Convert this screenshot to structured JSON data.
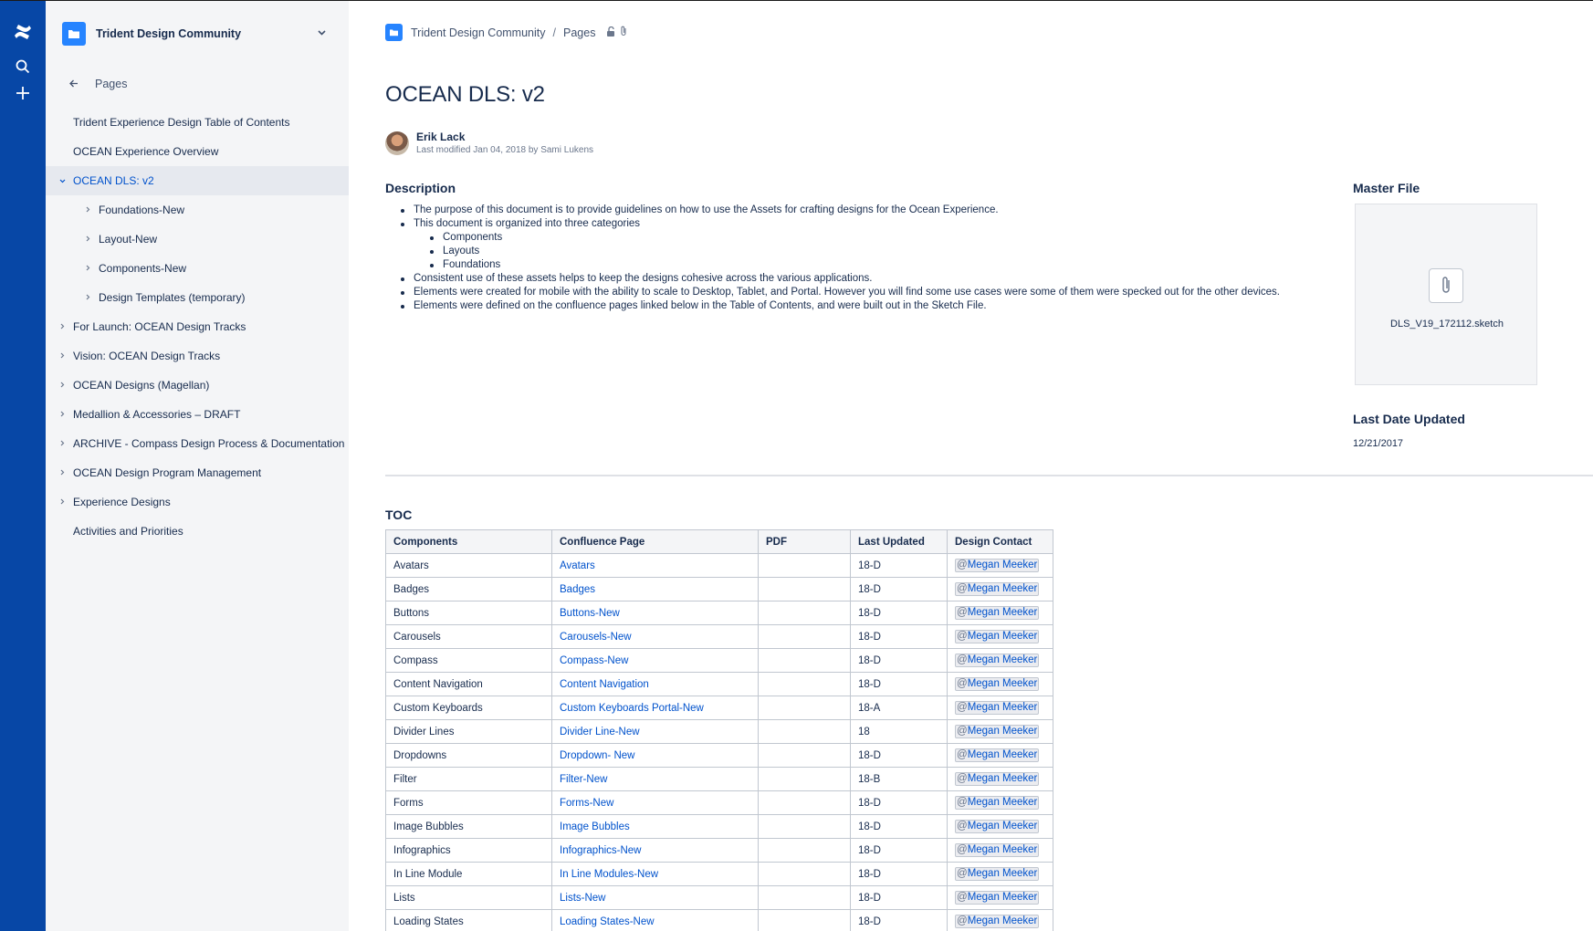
{
  "global_nav": {
    "icons": [
      "confluence-logo-icon",
      "search-icon",
      "create-icon"
    ]
  },
  "sidebar": {
    "space_name": "Trident Design Community",
    "pages_label": "Pages",
    "items": [
      {
        "label": "Trident Experience Design Table of Contents",
        "level": 0,
        "has_children": false,
        "expanded": false,
        "active": false
      },
      {
        "label": "OCEAN Experience Overview",
        "level": 0,
        "has_children": false,
        "expanded": false,
        "active": false
      },
      {
        "label": "OCEAN DLS: v2",
        "level": 0,
        "has_children": true,
        "expanded": true,
        "active": true
      },
      {
        "label": "Foundations-New",
        "level": 1,
        "has_children": true,
        "expanded": false,
        "active": false
      },
      {
        "label": "Layout-New",
        "level": 1,
        "has_children": true,
        "expanded": false,
        "active": false
      },
      {
        "label": "Components-New",
        "level": 1,
        "has_children": true,
        "expanded": false,
        "active": false
      },
      {
        "label": "Design Templates (temporary)",
        "level": 1,
        "has_children": true,
        "expanded": false,
        "active": false
      },
      {
        "label": "For Launch: OCEAN Design Tracks",
        "level": 0,
        "has_children": true,
        "expanded": false,
        "active": false
      },
      {
        "label": "Vision: OCEAN Design Tracks",
        "level": 0,
        "has_children": true,
        "expanded": false,
        "active": false
      },
      {
        "label": "OCEAN Designs (Magellan)",
        "level": 0,
        "has_children": true,
        "expanded": false,
        "active": false
      },
      {
        "label": "Medallion & Accessories – DRAFT",
        "level": 0,
        "has_children": true,
        "expanded": false,
        "active": false
      },
      {
        "label": "ARCHIVE - Compass Design Process & Documentation",
        "level": 0,
        "has_children": true,
        "expanded": false,
        "active": false
      },
      {
        "label": "OCEAN Design Program Management",
        "level": 0,
        "has_children": true,
        "expanded": false,
        "active": false
      },
      {
        "label": "Experience Designs",
        "level": 0,
        "has_children": true,
        "expanded": false,
        "active": false
      },
      {
        "label": "Activities and Priorities",
        "level": 0,
        "has_children": false,
        "expanded": false,
        "active": false
      }
    ]
  },
  "breadcrumb": {
    "space": "Trident Design Community",
    "separator": "/",
    "pages": "Pages"
  },
  "page": {
    "title": "OCEAN DLS: v2",
    "author": "Erik Lack",
    "last_modified": "Last modified Jan 04, 2018 by Sami Lukens"
  },
  "description": {
    "heading": "Description",
    "bullets": [
      {
        "text": "The purpose of this document is to provide guidelines on how to use the Assets for crafting designs for the Ocean Experience.",
        "level": 0
      },
      {
        "text": "This document is organized into three categories",
        "level": 0
      },
      {
        "text": "Components",
        "level": 1
      },
      {
        "text": "Layouts",
        "level": 1
      },
      {
        "text": "Foundations",
        "level": 1
      },
      {
        "text": " Consistent use of these assets helps to keep the designs cohesive across the various applications.",
        "level": 0
      },
      {
        "text": "Elements were created for mobile with the ability to scale to Desktop, Tablet, and Portal. However you will find some use cases were some of them were specked out for the other devices.",
        "level": 0
      },
      {
        "text": "Elements were defined on the confluence pages linked below in the Table of Contents, and were built out in the Sketch File.",
        "level": 0
      }
    ]
  },
  "master_file": {
    "heading": "Master File",
    "filename": "DLS_V19_172112.sketch"
  },
  "last_date_updated": {
    "heading": "Last Date Updated",
    "value": "12/21/2017"
  },
  "toc": {
    "heading": "TOC",
    "columns": [
      "Components",
      "Confluence Page",
      "PDF",
      "Last Updated",
      "Design Contact"
    ],
    "rows": [
      {
        "component": "Avatars",
        "page": "Avatars",
        "pdf": "",
        "updated": "18-D",
        "contact": "Megan Meeker"
      },
      {
        "component": "Badges",
        "page": "Badges",
        "pdf": "",
        "updated": "18-D",
        "contact": "Megan Meeker"
      },
      {
        "component": "Buttons",
        "page": "Buttons-New",
        "pdf": "",
        "updated": "18-D",
        "contact": "Megan Meeker"
      },
      {
        "component": "Carousels",
        "page": "Carousels-New",
        "pdf": "",
        "updated": "18-D",
        "contact": "Megan Meeker"
      },
      {
        "component": "Compass",
        "page": "Compass-New",
        "pdf": "",
        "updated": "18-D",
        "contact": "Megan Meeker"
      },
      {
        "component": "Content Navigation",
        "page": "Content Navigation",
        "pdf": "",
        "updated": "18-D",
        "contact": "Megan Meeker"
      },
      {
        "component": "Custom Keyboards",
        "page": "Custom Keyboards Portal-New",
        "pdf": "",
        "updated": "18-A",
        "contact": "Megan Meeker"
      },
      {
        "component": "Divider Lines",
        "page": "Divider Line-New",
        "pdf": "",
        "updated": "18",
        "contact": "Megan Meeker"
      },
      {
        "component": "Dropdowns",
        "page": "Dropdown- New",
        "pdf": "",
        "updated": "18-D",
        "contact": "Megan Meeker"
      },
      {
        "component": "Filter",
        "page": "Filter-New",
        "pdf": "",
        "updated": "18-B",
        "contact": "Megan Meeker"
      },
      {
        "component": "Forms",
        "page": "Forms-New",
        "pdf": "",
        "updated": "18-D",
        "contact": "Megan Meeker"
      },
      {
        "component": "Image Bubbles",
        "page": "Image Bubbles",
        "pdf": "",
        "updated": "18-D",
        "contact": "Megan Meeker"
      },
      {
        "component": "Infographics",
        "page": "Infographics-New",
        "pdf": "",
        "updated": "18-D",
        "contact": "Megan Meeker"
      },
      {
        "component": "In Line Module",
        "page": "In Line Modules-New",
        "pdf": "",
        "updated": "18-D",
        "contact": "Megan Meeker"
      },
      {
        "component": "Lists",
        "page": "Lists-New",
        "pdf": "",
        "updated": "18-D",
        "contact": "Megan Meeker"
      },
      {
        "component": "Loading States",
        "page": "Loading States-New",
        "pdf": "",
        "updated": "18-D",
        "contact": "Megan Meeker"
      }
    ]
  },
  "colors": {
    "global_nav": "#0747a6",
    "sidebar": "#f4f5f7",
    "link": "#0052cc",
    "space_icon": "#2684ff"
  }
}
